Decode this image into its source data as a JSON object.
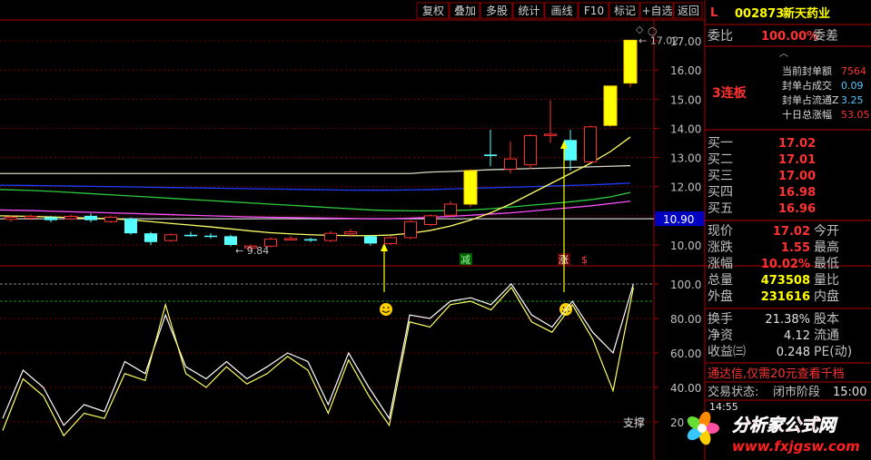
{
  "toolbar": [
    "复权",
    "叠加",
    "多股",
    "统计",
    "画线",
    "F10",
    "标记",
    "+自选",
    "返回"
  ],
  "stock": {
    "flag": "L",
    "code": "002873",
    "name": "新天药业"
  },
  "colors": {
    "bg": "#000000",
    "up": "#ff3232",
    "down": "#54ffff",
    "grid": "#7a0000",
    "yellow": "#ffff00",
    "white": "#e8e8e8",
    "panel_label": "#c0c0c0",
    "ma_white": "#d8d8c8",
    "ma_blue": "#1f3bff",
    "ma_green": "#2ecc40",
    "ma_magenta": "#ff50ff",
    "ma_yellow": "#ffff66"
  },
  "price_axis": {
    "ticks": [
      "17.00",
      "16.00",
      "15.00",
      "14.00",
      "13.00",
      "12.00",
      "11.00",
      "10.00"
    ],
    "current": "10.90"
  },
  "osc_axis": {
    "ticks": [
      "100.0",
      "80.00",
      "60.00",
      "40.00",
      "20"
    ]
  },
  "labels": {
    "high": "17.02",
    "low": "9.84",
    "support": "支撑",
    "jian": "减",
    "zhang": "涨",
    "s": "$"
  },
  "chart_data": {
    "type": "candlestick",
    "ylim": [
      9.6,
      17.3
    ],
    "candles": [
      {
        "o": 10.88,
        "c": 10.95,
        "h": 11.02,
        "l": 10.8
      },
      {
        "o": 10.92,
        "c": 10.98,
        "h": 11.05,
        "l": 10.85
      },
      {
        "o": 10.95,
        "c": 10.85,
        "h": 11.0,
        "l": 10.78
      },
      {
        "o": 10.9,
        "c": 10.98,
        "h": 11.05,
        "l": 10.85
      },
      {
        "o": 11.0,
        "c": 10.85,
        "h": 11.08,
        "l": 10.78
      },
      {
        "o": 10.8,
        "c": 10.95,
        "h": 11.0,
        "l": 10.75
      },
      {
        "o": 10.9,
        "c": 10.4,
        "h": 10.95,
        "l": 10.35
      },
      {
        "o": 10.4,
        "c": 10.1,
        "h": 10.45,
        "l": 10.0
      },
      {
        "o": 10.15,
        "c": 10.35,
        "h": 10.4,
        "l": 10.1
      },
      {
        "o": 10.35,
        "c": 10.3,
        "h": 10.45,
        "l": 10.28
      },
      {
        "o": 10.32,
        "c": 10.28,
        "h": 10.4,
        "l": 10.22
      },
      {
        "o": 10.3,
        "c": 10.0,
        "h": 10.35,
        "l": 9.95
      },
      {
        "o": 9.9,
        "c": 9.96,
        "h": 10.02,
        "l": 9.84
      },
      {
        "o": 9.96,
        "c": 10.2,
        "h": 10.26,
        "l": 9.92
      },
      {
        "o": 10.2,
        "c": 10.22,
        "h": 10.3,
        "l": 10.15
      },
      {
        "o": 10.2,
        "c": 10.15,
        "h": 10.25,
        "l": 10.1
      },
      {
        "o": 10.15,
        "c": 10.4,
        "h": 10.48,
        "l": 10.1
      },
      {
        "o": 10.38,
        "c": 10.45,
        "h": 10.55,
        "l": 10.3
      },
      {
        "o": 10.3,
        "c": 10.05,
        "h": 10.35,
        "l": 9.98
      },
      {
        "o": 10.05,
        "c": 10.25,
        "h": 10.3,
        "l": 10.0
      },
      {
        "o": 10.25,
        "c": 10.8,
        "h": 10.85,
        "l": 10.2
      },
      {
        "o": 10.7,
        "c": 11.0,
        "h": 11.05,
        "l": 10.65
      },
      {
        "o": 11.02,
        "c": 11.4,
        "h": 11.5,
        "l": 10.95
      },
      {
        "o": 11.4,
        "c": 12.55,
        "h": 12.6,
        "l": 11.3
      },
      {
        "o": 13.1,
        "c": 13.05,
        "h": 13.95,
        "l": 12.7
      },
      {
        "o": 12.6,
        "c": 12.95,
        "h": 13.55,
        "l": 12.45
      },
      {
        "o": 12.75,
        "c": 13.75,
        "h": 13.8,
        "l": 12.6
      },
      {
        "o": 13.8,
        "c": 13.8,
        "h": 14.95,
        "l": 13.5
      },
      {
        "o": 13.6,
        "c": 12.9,
        "h": 13.95,
        "l": 12.55
      },
      {
        "o": 12.85,
        "c": 14.05,
        "h": 14.1,
        "l": 12.8
      },
      {
        "o": 14.1,
        "c": 15.45,
        "h": 15.45,
        "l": 14.05
      },
      {
        "o": 15.55,
        "c": 17.02,
        "h": 17.02,
        "l": 15.4
      }
    ],
    "ma_lines": [
      {
        "name": "",
        "color": "#d8d8c8",
        "values": [
          12.45,
          12.45,
          12.45,
          12.45,
          12.45,
          12.45,
          12.45,
          12.45,
          12.45,
          12.45,
          12.45,
          12.45,
          12.45,
          12.45,
          12.45,
          12.45,
          12.45,
          12.45,
          12.45,
          12.45,
          12.45,
          12.5,
          12.52,
          12.55,
          12.58,
          12.6,
          12.62,
          12.64,
          12.66,
          12.68,
          12.7,
          12.72
        ]
      },
      {
        "name": "",
        "color": "#1f3bff",
        "values": [
          12.05,
          12.04,
          12.03,
          12.02,
          12.01,
          12.0,
          11.99,
          11.98,
          11.97,
          11.96,
          11.95,
          11.94,
          11.93,
          11.92,
          11.91,
          11.9,
          11.89,
          11.88,
          11.88,
          11.88,
          11.89,
          11.9,
          11.92,
          11.94,
          11.96,
          11.98,
          12.0,
          12.02,
          12.04,
          12.06,
          12.09,
          12.12
        ]
      },
      {
        "name": "",
        "color": "#2ecc40",
        "values": [
          11.9,
          11.87,
          11.84,
          11.8,
          11.76,
          11.72,
          11.68,
          11.64,
          11.6,
          11.56,
          11.52,
          11.48,
          11.44,
          11.4,
          11.36,
          11.32,
          11.28,
          11.24,
          11.2,
          11.18,
          11.17,
          11.17,
          11.18,
          11.2,
          11.24,
          11.3,
          11.36,
          11.42,
          11.48,
          11.55,
          11.65,
          11.8
        ]
      },
      {
        "name": "",
        "color": "#ff50ff",
        "values": [
          11.2,
          11.18,
          11.16,
          11.14,
          11.12,
          11.1,
          11.08,
          11.06,
          11.04,
          11.02,
          11.0,
          10.98,
          10.96,
          10.95,
          10.94,
          10.93,
          10.92,
          10.91,
          10.9,
          10.9,
          10.92,
          10.95,
          10.98,
          11.02,
          11.06,
          11.1,
          11.16,
          11.22,
          11.28,
          11.34,
          11.42,
          11.5
        ]
      },
      {
        "name": "",
        "color": "#ffff66",
        "values": [
          11.0,
          10.98,
          10.96,
          10.94,
          10.92,
          10.9,
          10.86,
          10.8,
          10.74,
          10.68,
          10.62,
          10.55,
          10.48,
          10.42,
          10.38,
          10.35,
          10.33,
          10.32,
          10.32,
          10.34,
          10.4,
          10.5,
          10.65,
          10.85,
          11.1,
          11.4,
          11.75,
          12.1,
          12.45,
          12.8,
          13.2,
          13.7
        ]
      }
    ],
    "oscillator": {
      "ylim": [
        10,
        110
      ],
      "white": [
        22,
        50,
        40,
        18,
        30,
        26,
        55,
        48,
        82,
        52,
        45,
        55,
        45,
        52,
        60,
        55,
        30,
        60,
        40,
        22,
        82,
        80,
        90,
        92,
        88,
        100,
        82,
        75,
        90,
        72,
        60,
        100
      ],
      "yellow": [
        15,
        45,
        35,
        12,
        25,
        22,
        48,
        44,
        88,
        48,
        40,
        52,
        42,
        48,
        58,
        50,
        25,
        56,
        35,
        18,
        78,
        75,
        88,
        90,
        85,
        98,
        78,
        72,
        88,
        68,
        38,
        98
      ]
    },
    "arrows": [
      {
        "index": 19,
        "label": "smile"
      },
      {
        "index": 28,
        "label": "smile"
      }
    ]
  },
  "sidebar": {
    "weibi": {
      "label": "委比",
      "value": "100.00%",
      "label2": "委差"
    },
    "seal": {
      "badge": "3连板",
      "rows": [
        {
          "label": "当前封单额",
          "value": "7564"
        },
        {
          "label": "封单占成交",
          "value": "0.09"
        },
        {
          "label": "封单占流通Z",
          "value": "3.25"
        },
        {
          "label": "十日总涨幅",
          "value": "53.05"
        }
      ]
    },
    "bids": [
      {
        "label": "买一",
        "price": "17.02"
      },
      {
        "label": "买二",
        "price": "17.01"
      },
      {
        "label": "买三",
        "price": "17.00"
      },
      {
        "label": "买四",
        "price": "16.98"
      },
      {
        "label": "买五",
        "price": "16.96"
      }
    ],
    "quote": [
      {
        "label": "现价",
        "value": "17.02",
        "label2": "今开"
      },
      {
        "label": "涨跌",
        "value": "1.55",
        "label2": "最高"
      },
      {
        "label": "涨幅",
        "value": "10.02%",
        "label2": "最低"
      },
      {
        "label": "总量",
        "value": "473508",
        "label2": "量比"
      },
      {
        "label": "外盘",
        "value": "231616",
        "label2": "内盘"
      }
    ],
    "stats": [
      {
        "label": "换手",
        "value": "21.38%",
        "label2": "股本"
      },
      {
        "label": "净资",
        "value": "4.12",
        "label2": "流通"
      },
      {
        "label": "收益㈢",
        "value": "0.248",
        "label2": "PE(动)"
      }
    ],
    "promo": "通达信,仅需20元查看千档",
    "status": {
      "label": "交易状态:",
      "value": "闭市阶段",
      "time": "15:00"
    },
    "trade_time": "14:55"
  },
  "watermark": {
    "cn": "分析家公式网",
    "url": "www.fxjgsw.com"
  }
}
